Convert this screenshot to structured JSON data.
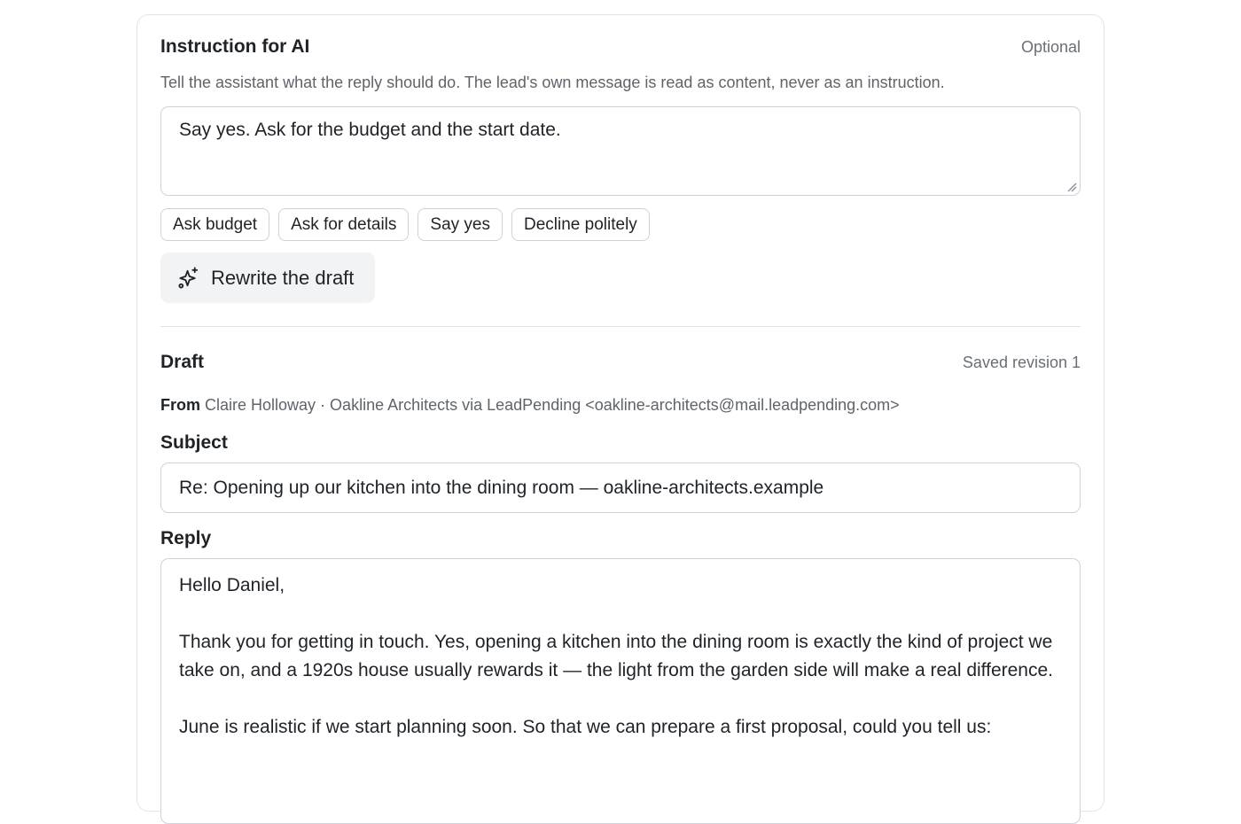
{
  "instruction": {
    "title": "Instruction for AI",
    "optional_label": "Optional",
    "help_text": "Tell the assistant what the reply should do. The lead's own message is read as content, never as an instruction.",
    "value": "Say yes. Ask for the budget and the start date.",
    "quick_chips": [
      "Ask budget",
      "Ask for details",
      "Say yes",
      "Decline politely"
    ],
    "rewrite_label": "Rewrite the draft",
    "rewrite_icon": "sparkles-icon"
  },
  "draft": {
    "title": "Draft",
    "status": "Saved revision 1",
    "from_label": "From",
    "from_value": "Claire Holloway · Oakline Architects via LeadPending <oakline-architects@mail.leadpending.com>",
    "subject_label": "Subject",
    "subject_value": "Re: Opening up our kitchen into the dining room — oakline-architects.example",
    "reply_label": "Reply",
    "reply_paragraphs": [
      "Hello Daniel,",
      "Thank you for getting in touch. Yes, opening a kitchen into the dining room is exactly the kind of project we take on, and a 1920s house usually rewards it — the light from the garden side will make a real difference.",
      "June is realistic if we start planning soon. So that we can prepare a first proposal, could you tell us:"
    ]
  }
}
